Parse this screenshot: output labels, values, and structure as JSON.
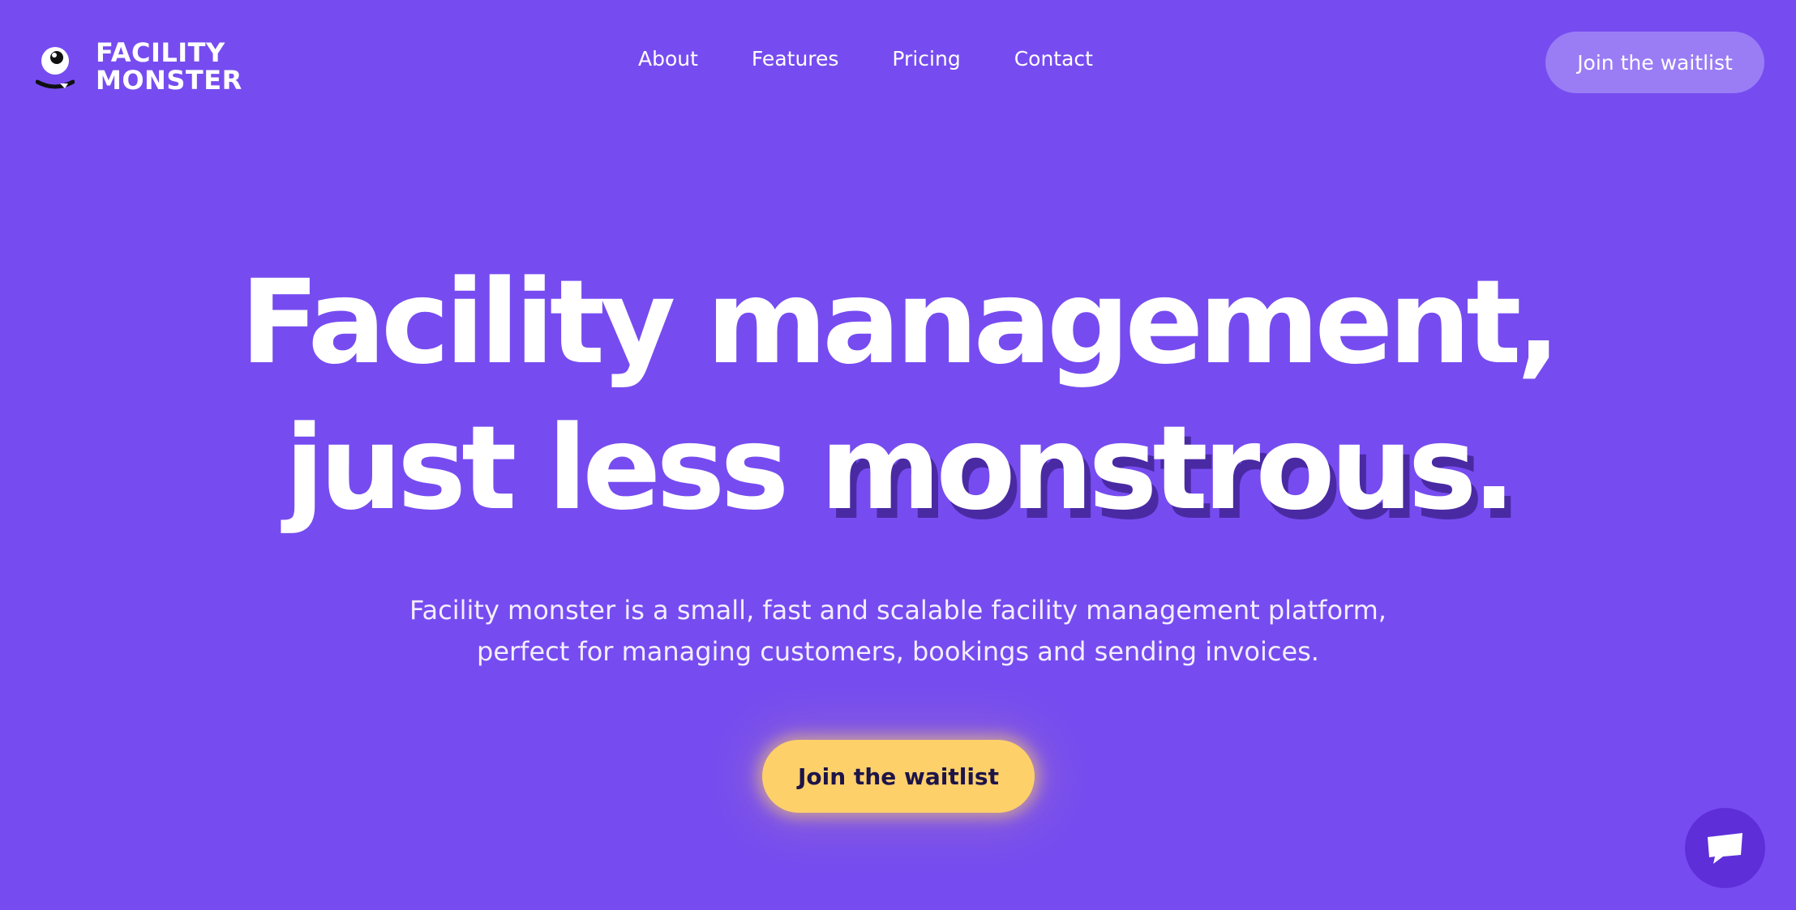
{
  "brand": {
    "line1": "FACILITY",
    "line2": "MONSTER",
    "icon": "monster-eye-logo-icon"
  },
  "nav": {
    "items": [
      {
        "label": "About"
      },
      {
        "label": "Features"
      },
      {
        "label": "Pricing"
      },
      {
        "label": "Contact"
      }
    ]
  },
  "header": {
    "cta_label": "Join the waitlist"
  },
  "hero": {
    "title_line1": "Facility management,",
    "title_line2_plain": "just less",
    "title_line2_emphasis": "monstrous.",
    "subtitle_line1": "Facility monster is a small, fast and scalable facility management platform,",
    "subtitle_line2": "perfect for managing customers, bookings and sending invoices.",
    "cta_label": "Join the waitlist"
  },
  "chat": {
    "icon": "chat-icon"
  },
  "colors": {
    "background": "#764cf0",
    "header_button": "#9a7df5",
    "primary_button": "#fdd06a",
    "primary_button_text": "#1d1448",
    "title_shadow": "#4a2aa3",
    "chat_button": "#5e2fd8"
  }
}
